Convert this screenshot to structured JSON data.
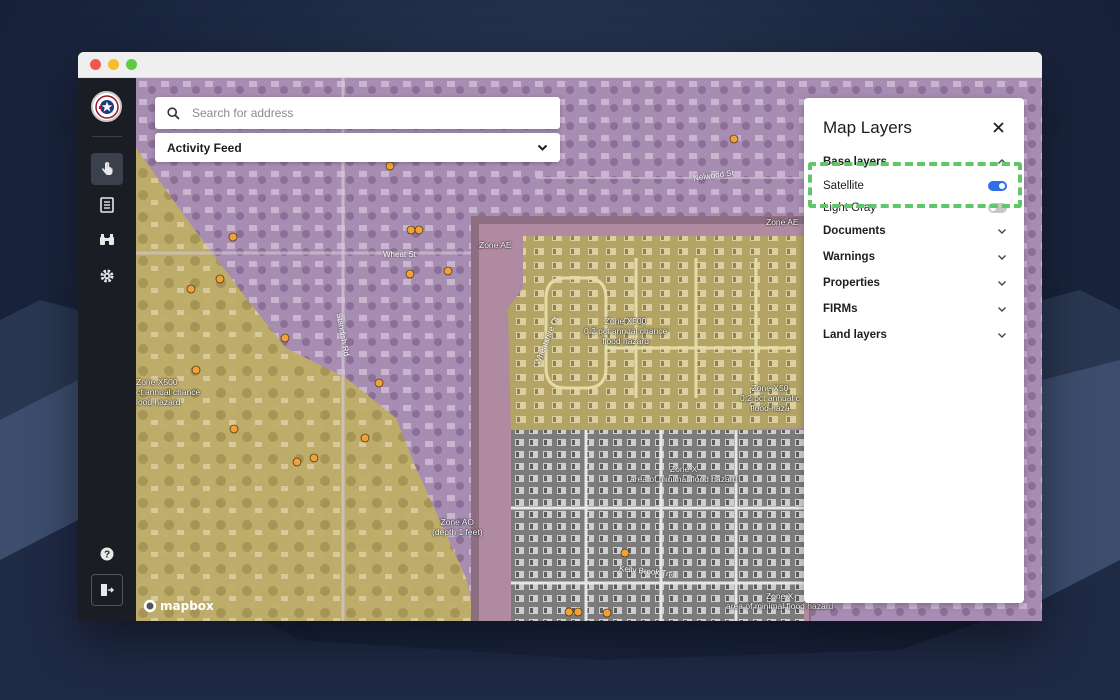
{
  "search": {
    "placeholder": "Search for address"
  },
  "activity_feed": {
    "label": "Activity Feed"
  },
  "map_labels": {
    "zone_ae_left": "Zone AE",
    "zone_ae_right": "Zone AE",
    "zone_x500_center": "Zone X500\n0.2 pct annual chance\nflood hazard",
    "zone_x500_left": "Zone X500\nct annual chance\nlood hazard",
    "zone_x500_right": "Zone X50\n0.2 pct annual c\nflood haza",
    "zone_x_center": "Zone X\narea of minimal flood hazard",
    "zone_x_bottom": "Zone X\narea of minimal flood hazard",
    "zone_ao": "Zone AO\n(depth 1 feet)",
    "streets": {
      "nelwood": "Nelwood St",
      "wheat": "Wheat St",
      "standish": "Standish Rd",
      "wheatshire": "Wheatshire Dr",
      "kelly_brook": "Kelly Brook Trail"
    }
  },
  "attribution": {
    "logo_text": "mapbox"
  },
  "layers_panel": {
    "title": "Map Layers",
    "base_layers_label": "Base layers",
    "base_options": [
      {
        "label": "Satellite",
        "enabled": true
      },
      {
        "label": "Light Gray",
        "enabled": false
      }
    ],
    "sections": [
      {
        "label": "Documents"
      },
      {
        "label": "Warnings"
      },
      {
        "label": "Properties"
      },
      {
        "label": "FIRMs"
      },
      {
        "label": "Land layers"
      }
    ]
  },
  "colors": {
    "zone_ae_purple": "#a98cb3",
    "zone_x500_yellow": "#c5b66a",
    "zone_x_gray": "#8a8a8a",
    "toggle_on": "#2f6fe6",
    "highlight_green": "#5fc66a",
    "sidebar_bg": "#1a1d24",
    "marker_orange": "#f0a23a"
  },
  "icons": {
    "sidebar": [
      "hand-pointer-icon",
      "document-list-icon",
      "binoculars-icon",
      "gear-icon",
      "help-icon",
      "logout-icon"
    ]
  }
}
